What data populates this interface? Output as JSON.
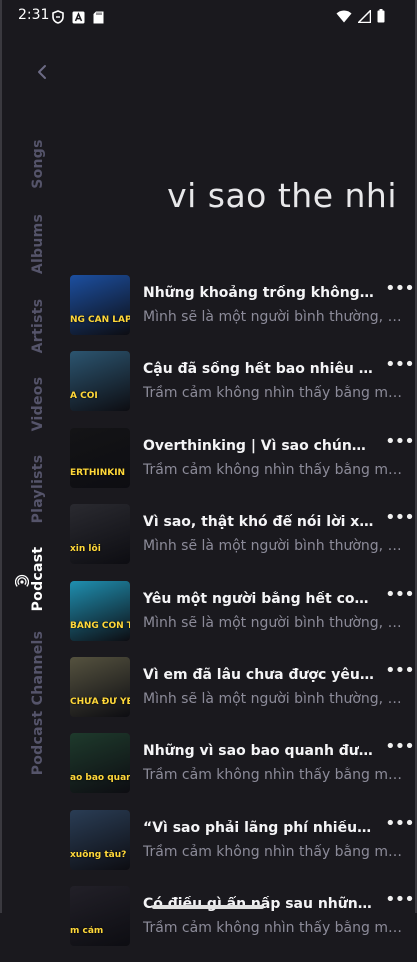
{
  "status": {
    "time": "2:31",
    "left_icons": [
      "shield-icon",
      "a-box-icon",
      "sd-card-icon"
    ],
    "right_icons": [
      "wifi-icon",
      "signal-icon",
      "battery-icon"
    ]
  },
  "nav": {
    "back_icon": "chevron-left-icon",
    "tabs": [
      {
        "label": "Songs",
        "active": false
      },
      {
        "label": "Albums",
        "active": false
      },
      {
        "label": "Artists",
        "active": false
      },
      {
        "label": "Videos",
        "active": false
      },
      {
        "label": "Playlists",
        "active": false
      },
      {
        "label": "Podcast",
        "active": true
      },
      {
        "label": "Podcast Channels",
        "active": false
      }
    ]
  },
  "search": {
    "query": "vi sao the nhi"
  },
  "episodes": [
    {
      "title": "Những khoảng trống không cần lấp đầy",
      "subtitle": "Mình sẽ là một người bình thường, sống",
      "thumb_caption": "NG CẦN LẤP Đ",
      "thumb_color": "#1c4fa0"
    },
    {
      "title": "Cậu đã sống hết bao nhiêu phần trăm",
      "subtitle": "Trầm cảm không nhìn thấy bằng mắt thường",
      "thumb_caption": "À CỖI",
      "thumb_color": "#2c5570"
    },
    {
      "title": "Overthinking | Vì sao chúng ta lại nghĩ",
      "subtitle": "Trầm cảm không nhìn thấy bằng mắt thường",
      "thumb_caption": "ERTHINKIN",
      "thumb_color": "#141416"
    },
    {
      "title": "Vì sao, thật khó để nói lời xin lỗi?",
      "subtitle": "Mình sẽ là một người bình thường, sống",
      "thumb_caption": "xin lỗi",
      "thumb_color": "#2a2a30"
    },
    {
      "title": "Yêu một người bằng hết con tim mình",
      "subtitle": "Mình sẽ là một người bình thường, sống",
      "thumb_caption": "BẰNG CON TI",
      "thumb_color": "#1f8fb0"
    },
    {
      "title": "Vì em đã lâu chưa được yêu nhiều",
      "subtitle": "Mình sẽ là một người bình thường, sống",
      "thumb_caption": "CHƯA ĐƯ YÊU NHI",
      "thumb_color": "#55523f"
    },
    {
      "title": "Những vì sao bao quanh đường sống",
      "subtitle": "Trầm cảm không nhìn thấy bằng mắt thường",
      "thumb_caption": "ao bao quanh đường s",
      "thumb_color": "#1e3a2c"
    },
    {
      "title": "“Vì sao phải lãng phí nhiều thì giờ",
      "subtitle": "Trầm cảm không nhìn thấy bằng mắt thường",
      "thumb_caption": "xuống tàu?",
      "thumb_color": "#2a3d55"
    },
    {
      "title": "Có điều gì ẩn nấp sau những nụ cười",
      "subtitle": "Trầm cảm không nhìn thấy bằng mắt thường",
      "thumb_caption": "m cảm",
      "thumb_color": "#222028"
    }
  ],
  "more_label": "•••"
}
